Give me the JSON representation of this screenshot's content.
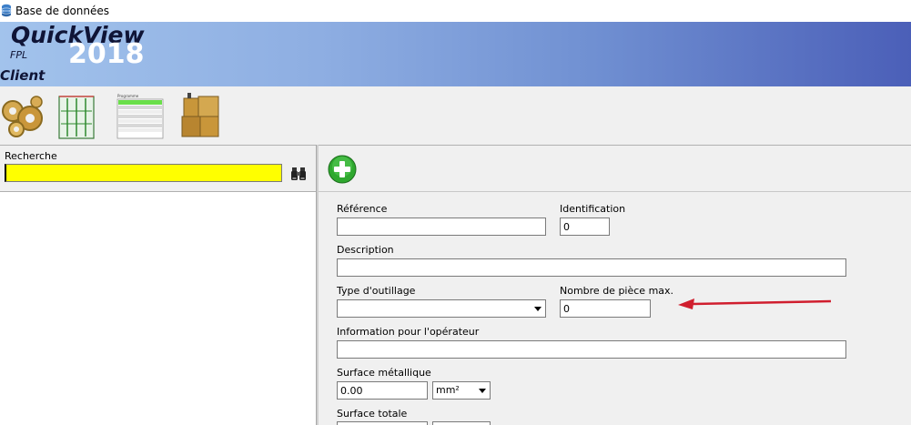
{
  "window": {
    "title": "Base de données"
  },
  "banner": {
    "brand": "QuickView",
    "year": "2018",
    "sub": "FPL",
    "module": "Client"
  },
  "toolbar": {
    "items": [
      {
        "name": "gears-tool"
      },
      {
        "name": "rack-tool"
      },
      {
        "name": "program-list-tool",
        "heading": "Programme"
      },
      {
        "name": "boxes-tool"
      }
    ]
  },
  "search": {
    "label": "Recherche",
    "value": ""
  },
  "form": {
    "reference": {
      "label": "Référence",
      "value": ""
    },
    "identification": {
      "label": "Identification",
      "value": "0"
    },
    "description": {
      "label": "Description",
      "value": ""
    },
    "tool_type": {
      "label": "Type d'outillage",
      "value": ""
    },
    "max_parts": {
      "label": "Nombre de pièce max.",
      "value": "0"
    },
    "operator_info": {
      "label": "Information pour l'opérateur",
      "value": ""
    },
    "metal_surface": {
      "label": "Surface métallique",
      "value": "0.00",
      "unit": "mm²"
    },
    "total_surface": {
      "label": "Surface totale"
    }
  },
  "colors": {
    "search_bg": "#ffff00",
    "add_green": "#2fa82f",
    "arrow_red": "#d01e2e"
  }
}
